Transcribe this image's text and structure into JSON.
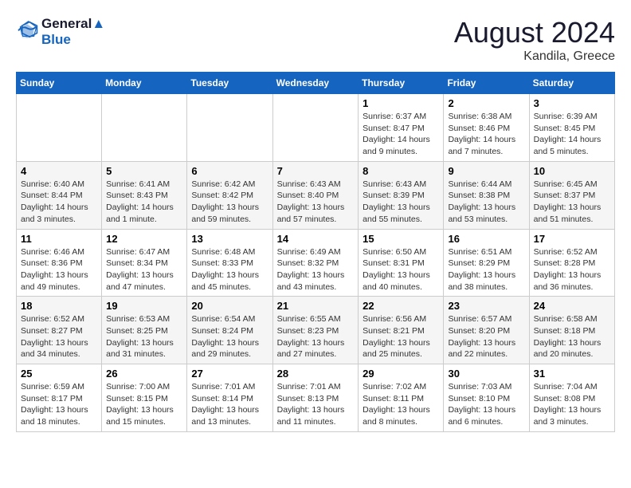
{
  "header": {
    "logo_line1": "General",
    "logo_line2": "Blue",
    "month_year": "August 2024",
    "location": "Kandila, Greece"
  },
  "days_of_week": [
    "Sunday",
    "Monday",
    "Tuesday",
    "Wednesday",
    "Thursday",
    "Friday",
    "Saturday"
  ],
  "weeks": [
    [
      {
        "day": "",
        "info": ""
      },
      {
        "day": "",
        "info": ""
      },
      {
        "day": "",
        "info": ""
      },
      {
        "day": "",
        "info": ""
      },
      {
        "day": "1",
        "info": "Sunrise: 6:37 AM\nSunset: 8:47 PM\nDaylight: 14 hours\nand 9 minutes."
      },
      {
        "day": "2",
        "info": "Sunrise: 6:38 AM\nSunset: 8:46 PM\nDaylight: 14 hours\nand 7 minutes."
      },
      {
        "day": "3",
        "info": "Sunrise: 6:39 AM\nSunset: 8:45 PM\nDaylight: 14 hours\nand 5 minutes."
      }
    ],
    [
      {
        "day": "4",
        "info": "Sunrise: 6:40 AM\nSunset: 8:44 PM\nDaylight: 14 hours\nand 3 minutes."
      },
      {
        "day": "5",
        "info": "Sunrise: 6:41 AM\nSunset: 8:43 PM\nDaylight: 14 hours\nand 1 minute."
      },
      {
        "day": "6",
        "info": "Sunrise: 6:42 AM\nSunset: 8:42 PM\nDaylight: 13 hours\nand 59 minutes."
      },
      {
        "day": "7",
        "info": "Sunrise: 6:43 AM\nSunset: 8:40 PM\nDaylight: 13 hours\nand 57 minutes."
      },
      {
        "day": "8",
        "info": "Sunrise: 6:43 AM\nSunset: 8:39 PM\nDaylight: 13 hours\nand 55 minutes."
      },
      {
        "day": "9",
        "info": "Sunrise: 6:44 AM\nSunset: 8:38 PM\nDaylight: 13 hours\nand 53 minutes."
      },
      {
        "day": "10",
        "info": "Sunrise: 6:45 AM\nSunset: 8:37 PM\nDaylight: 13 hours\nand 51 minutes."
      }
    ],
    [
      {
        "day": "11",
        "info": "Sunrise: 6:46 AM\nSunset: 8:36 PM\nDaylight: 13 hours\nand 49 minutes."
      },
      {
        "day": "12",
        "info": "Sunrise: 6:47 AM\nSunset: 8:34 PM\nDaylight: 13 hours\nand 47 minutes."
      },
      {
        "day": "13",
        "info": "Sunrise: 6:48 AM\nSunset: 8:33 PM\nDaylight: 13 hours\nand 45 minutes."
      },
      {
        "day": "14",
        "info": "Sunrise: 6:49 AM\nSunset: 8:32 PM\nDaylight: 13 hours\nand 43 minutes."
      },
      {
        "day": "15",
        "info": "Sunrise: 6:50 AM\nSunset: 8:31 PM\nDaylight: 13 hours\nand 40 minutes."
      },
      {
        "day": "16",
        "info": "Sunrise: 6:51 AM\nSunset: 8:29 PM\nDaylight: 13 hours\nand 38 minutes."
      },
      {
        "day": "17",
        "info": "Sunrise: 6:52 AM\nSunset: 8:28 PM\nDaylight: 13 hours\nand 36 minutes."
      }
    ],
    [
      {
        "day": "18",
        "info": "Sunrise: 6:52 AM\nSunset: 8:27 PM\nDaylight: 13 hours\nand 34 minutes."
      },
      {
        "day": "19",
        "info": "Sunrise: 6:53 AM\nSunset: 8:25 PM\nDaylight: 13 hours\nand 31 minutes."
      },
      {
        "day": "20",
        "info": "Sunrise: 6:54 AM\nSunset: 8:24 PM\nDaylight: 13 hours\nand 29 minutes."
      },
      {
        "day": "21",
        "info": "Sunrise: 6:55 AM\nSunset: 8:23 PM\nDaylight: 13 hours\nand 27 minutes."
      },
      {
        "day": "22",
        "info": "Sunrise: 6:56 AM\nSunset: 8:21 PM\nDaylight: 13 hours\nand 25 minutes."
      },
      {
        "day": "23",
        "info": "Sunrise: 6:57 AM\nSunset: 8:20 PM\nDaylight: 13 hours\nand 22 minutes."
      },
      {
        "day": "24",
        "info": "Sunrise: 6:58 AM\nSunset: 8:18 PM\nDaylight: 13 hours\nand 20 minutes."
      }
    ],
    [
      {
        "day": "25",
        "info": "Sunrise: 6:59 AM\nSunset: 8:17 PM\nDaylight: 13 hours\nand 18 minutes."
      },
      {
        "day": "26",
        "info": "Sunrise: 7:00 AM\nSunset: 8:15 PM\nDaylight: 13 hours\nand 15 minutes."
      },
      {
        "day": "27",
        "info": "Sunrise: 7:01 AM\nSunset: 8:14 PM\nDaylight: 13 hours\nand 13 minutes."
      },
      {
        "day": "28",
        "info": "Sunrise: 7:01 AM\nSunset: 8:13 PM\nDaylight: 13 hours\nand 11 minutes."
      },
      {
        "day": "29",
        "info": "Sunrise: 7:02 AM\nSunset: 8:11 PM\nDaylight: 13 hours\nand 8 minutes."
      },
      {
        "day": "30",
        "info": "Sunrise: 7:03 AM\nSunset: 8:10 PM\nDaylight: 13 hours\nand 6 minutes."
      },
      {
        "day": "31",
        "info": "Sunrise: 7:04 AM\nSunset: 8:08 PM\nDaylight: 13 hours\nand 3 minutes."
      }
    ]
  ]
}
